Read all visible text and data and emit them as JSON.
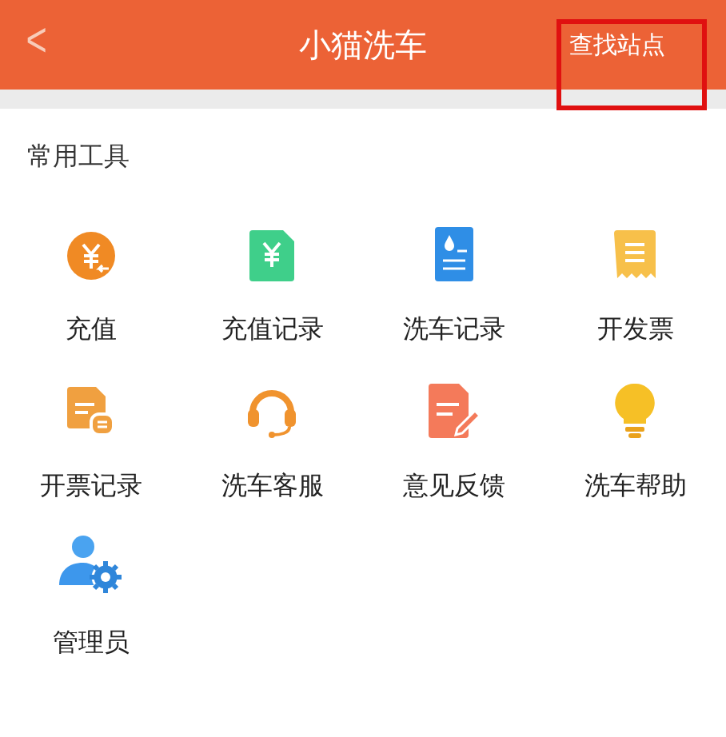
{
  "header": {
    "back": "<",
    "title": "小猫洗车",
    "action": {
      "label": "查找站点",
      "highlighted": true
    }
  },
  "section": {
    "title": "常用工具"
  },
  "tools": [
    {
      "label": "充值",
      "kind": "coin"
    },
    {
      "label": "充值记录",
      "kind": "receipt"
    },
    {
      "label": "洗车记录",
      "kind": "wash"
    },
    {
      "label": "开发票",
      "kind": "invoice"
    },
    {
      "label": "开票记录",
      "kind": "invoicelog"
    },
    {
      "label": "洗车客服",
      "kind": "headset"
    },
    {
      "label": "意见反馈",
      "kind": "feedback"
    },
    {
      "label": "洗车帮助",
      "kind": "bulb"
    },
    {
      "label": "管理员",
      "kind": "admin"
    }
  ]
}
